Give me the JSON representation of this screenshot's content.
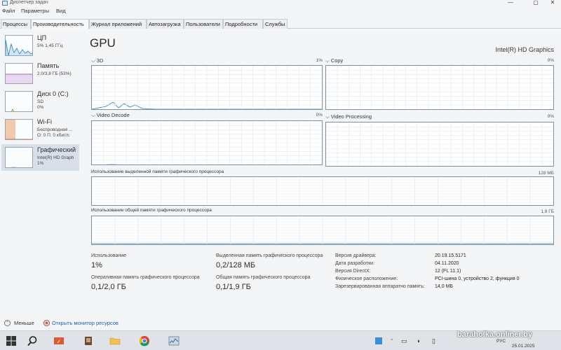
{
  "window": {
    "title": "Диспетчер задач",
    "controls": {
      "minimize": "—",
      "maximize": "▢",
      "close": "✕"
    }
  },
  "menu": [
    "Файл",
    "Параметры",
    "Вид"
  ],
  "tabs": [
    {
      "label": "Процессы",
      "active": false
    },
    {
      "label": "Производительность",
      "active": true
    },
    {
      "label": "Журнал приложений",
      "active": false
    },
    {
      "label": "Автозагрузка",
      "active": false
    },
    {
      "label": "Пользователи",
      "active": false
    },
    {
      "label": "Подробности",
      "active": false
    },
    {
      "label": "Службы",
      "active": false
    }
  ],
  "sidebar": {
    "items": [
      {
        "name": "ЦП",
        "sub1": "5% 1,45 ГГц",
        "sub2": "",
        "color": "#1b7fc4"
      },
      {
        "name": "Память",
        "sub1": "2,0/3,8 ГБ (53%)",
        "sub2": "",
        "color": "#8a3ca8"
      },
      {
        "name": "Диск 0 (C:)",
        "sub1": "SD",
        "sub2": "0%",
        "color": "#4a9a30"
      },
      {
        "name": "Wi-Fi",
        "sub1": "Беспроводная ...",
        "sub2": "О: 0 П: 0 кбит/с",
        "color": "#c06020"
      },
      {
        "name": "Графический",
        "sub1": "Intel(R) HD Graph",
        "sub2": "1%",
        "color": "#1b7fc4"
      }
    ]
  },
  "gpu": {
    "title": "GPU",
    "name": "Intel(R) HD Graphics",
    "graphs": [
      {
        "label": "3D",
        "pct": "1%"
      },
      {
        "label": "Copy",
        "pct": "0%"
      },
      {
        "label": "Video Decode",
        "pct": "0%"
      },
      {
        "label": "Video Processing",
        "pct": "0%"
      }
    ],
    "dedicated_label": "Использование выделенной памяти графического процессора",
    "dedicated_max": "128 МБ",
    "shared_label": "Использование общей памяти графического процессора",
    "shared_max": "1,9 ГБ"
  },
  "stats": {
    "usage_label": "Использование",
    "usage_value": "1%",
    "gpu_mem_label": "Оперативная память графического процессора",
    "gpu_mem_value": "0,1/2,0 ГБ",
    "dedicated_label": "Выделенная память графического процессора",
    "dedicated_value": "0,2/128 МБ",
    "shared_label": "Общая память графического процессора",
    "shared_value": "0,1/1,9 ГБ"
  },
  "info": [
    {
      "label": "Версия драйвера:",
      "value": "20.19.15.5171"
    },
    {
      "label": "Дата разработки:",
      "value": "04.11.2020"
    },
    {
      "label": "Версия DirectX:",
      "value": "12 (FL 11.1)"
    },
    {
      "label": "Физическое расположение:",
      "value": "PCI-шина 0, устройство 2, функция 0"
    },
    {
      "label": "Зарезервированная аппаратно память:",
      "value": "14,0 МБ"
    }
  ],
  "footer": {
    "less_label": "Меньше",
    "monitor_label": "Открыть монитор ресурсов"
  },
  "taskbar": {
    "lang": "РУС",
    "date": "25.01.2025",
    "watermark": "baraholka.onliner.by"
  },
  "colors": {
    "accent": "#1b7fc4",
    "graph_border": "#7e8fa3",
    "grid": "#e2e7ee"
  }
}
